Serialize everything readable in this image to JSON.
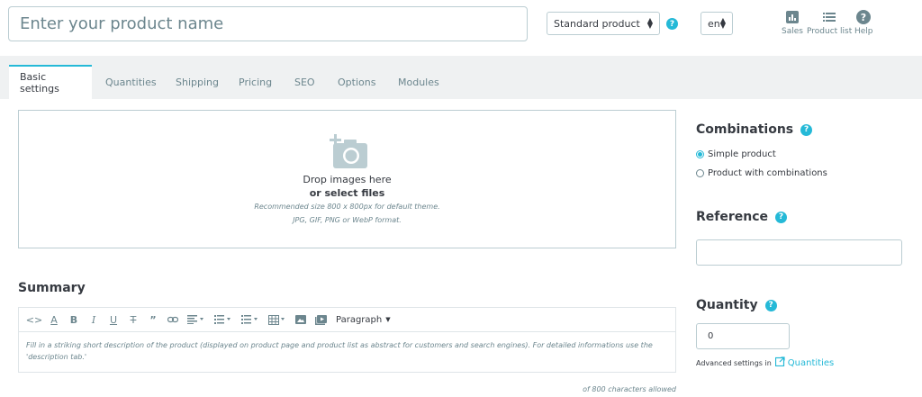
{
  "header": {
    "product_name_placeholder": "Enter your product name",
    "product_type": "Standard product",
    "language": "en",
    "help_symbol": "?",
    "toolbar": [
      {
        "label": "Sales",
        "icon": "bar-chart-icon"
      },
      {
        "label": "Product list",
        "icon": "list-icon"
      },
      {
        "label": "Help",
        "icon": "help-icon"
      }
    ]
  },
  "tabs": [
    {
      "label": "Basic settings",
      "active": true
    },
    {
      "label": "Quantities",
      "active": false
    },
    {
      "label": "Shipping",
      "active": false
    },
    {
      "label": "Pricing",
      "active": false
    },
    {
      "label": "SEO",
      "active": false
    },
    {
      "label": "Options",
      "active": false
    },
    {
      "label": "Modules",
      "active": false
    }
  ],
  "dropzone": {
    "icon": "camera-add-icon",
    "line1": "Drop images here",
    "line2": "or select files",
    "line3": "Recommended size 800 x 800px for default theme.",
    "line4": "JPG, GIF, PNG or WebP format."
  },
  "summary": {
    "title": "Summary",
    "paragraph_label": "Paragraph",
    "placeholder": "Fill in a striking short description of the product (displayed on product page and product list as abstract for customers and search engines). For detailed informations use the 'description tab.'",
    "char_count": "of 800 characters allowed"
  },
  "combinations": {
    "title": "Combinations",
    "options": [
      {
        "label": "Simple product",
        "checked": true
      },
      {
        "label": "Product with combinations",
        "checked": false
      }
    ]
  },
  "reference": {
    "title": "Reference",
    "value": ""
  },
  "quantity": {
    "title": "Quantity",
    "value": "0",
    "advanced_text": "Advanced settings in",
    "advanced_link": "Quantities"
  },
  "colors": {
    "accent": "#25b9d7",
    "text": "#363a41",
    "muted": "#6c868e",
    "border": "#bbcdd2",
    "tab_bar_bg": "#eff1f2"
  }
}
